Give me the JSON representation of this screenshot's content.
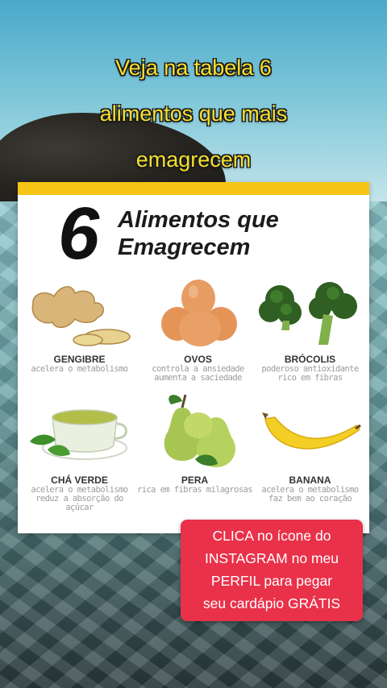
{
  "headline": [
    "Veja na tabela 6",
    "alimentos que mais",
    "emagrecem"
  ],
  "card": {
    "number": "6",
    "title_line1": "Alimentos que",
    "title_line2": "Emagrecem"
  },
  "foods": [
    {
      "name": "GENGIBRE",
      "desc": [
        "acelera o metabolismo"
      ],
      "icon": "ginger-icon"
    },
    {
      "name": "OVOS",
      "desc": [
        "controla a ansiedade",
        "aumenta a saciedade"
      ],
      "icon": "eggs-icon"
    },
    {
      "name": "BRÓCOLIS",
      "desc": [
        "poderoso antioxidante",
        "rico em fibras"
      ],
      "icon": "broccoli-icon"
    },
    {
      "name": "CHÁ VERDE",
      "desc": [
        "acelera o metabolismo",
        "reduz a absorção do açúcar"
      ],
      "icon": "green-tea-icon"
    },
    {
      "name": "PERA",
      "desc": [
        "rica em fibras milagrosas"
      ],
      "icon": "pear-icon"
    },
    {
      "name": "BANANA",
      "desc": [
        "acelera o metabolismo",
        "faz bem ao coração"
      ],
      "icon": "banana-icon"
    }
  ],
  "cta": [
    "CLICA no ícone do",
    "INSTAGRAM no meu",
    "PERFIL para pegar",
    "seu cardápio GRÁTIS"
  ],
  "colors": {
    "headline": "#f6df2f",
    "card_bar": "#f6c515",
    "cta_bg": "#e9314a"
  }
}
